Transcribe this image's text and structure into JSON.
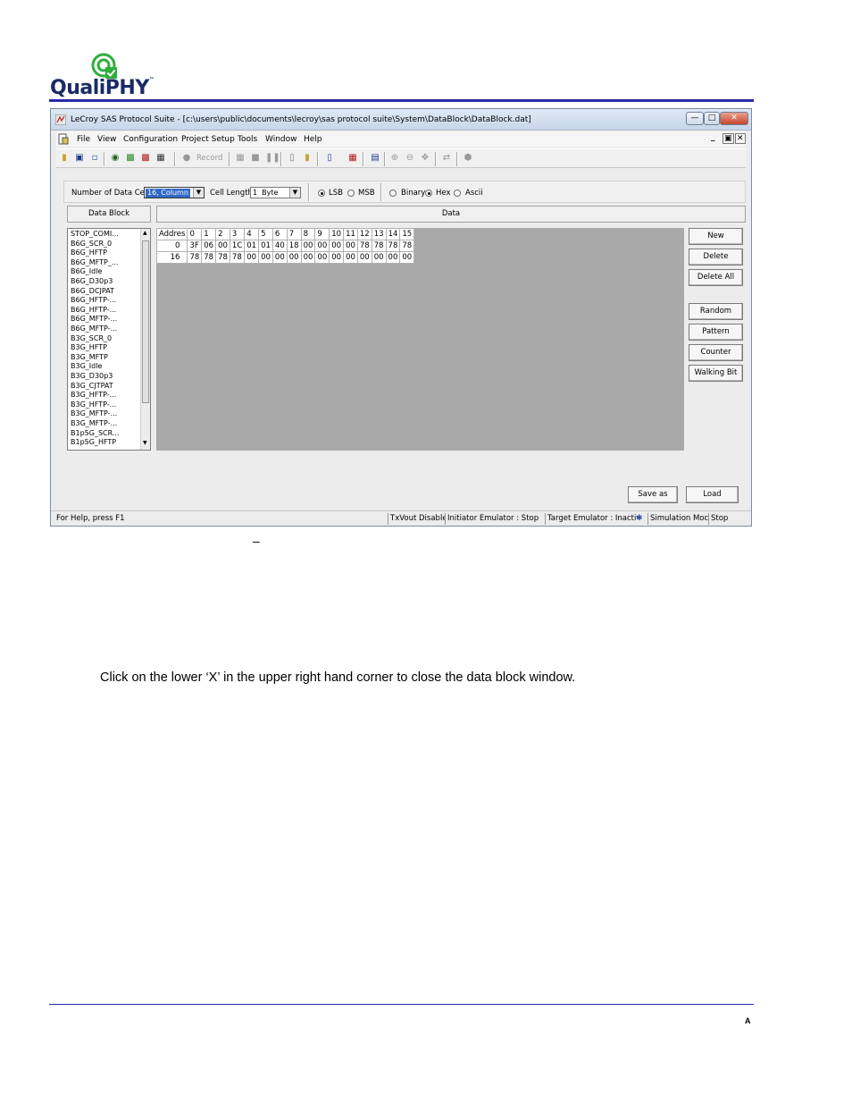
{
  "header": {
    "logo_text": "QualiPHY",
    "logo_tm": "™",
    "page_letter": "A"
  },
  "window": {
    "title": "LeCroy SAS Protocol Suite - [c:\\users\\public\\documents\\lecroy\\sas protocol suite\\System\\DataBlock\\DataBlock.dat]",
    "controls": [
      "—",
      "□",
      "✕"
    ],
    "mdi_controls": [
      "_",
      "▣",
      "✕"
    ],
    "menu": [
      "File",
      "View",
      "Configuration",
      "Project Setup",
      "Tools",
      "Window",
      "Help"
    ],
    "toolbar": {
      "record_label": "Record"
    }
  },
  "controls": {
    "num_cells_label": "Number of Data Cells:",
    "num_cells_value": "16, Column",
    "cell_length_label": "Cell Length:",
    "cell_length_value": "1  Byte",
    "bit_order": {
      "options": [
        "LSB",
        "MSB"
      ],
      "selected": "LSB"
    },
    "format": {
      "options": [
        "Binary",
        "Hex",
        "Ascii"
      ],
      "selected": "Hex"
    }
  },
  "panels": {
    "datablock_header": "Data Block",
    "data_header": "Data"
  },
  "datablock_list": [
    "STOP_COMI...",
    "B6G_SCR_0",
    "B6G_HFTP",
    "B6G_MFTP_...",
    "B6G_Idle",
    "B6G_D30p3",
    "B6G_DCJPAT",
    "B6G_HFTP-...",
    "B6G_HFTP-...",
    "B6G_MFTP-...",
    "B6G_MFTP-...",
    "B3G_SCR_0",
    "B3G_HFTP",
    "B3G_MFTP",
    "B3G_Idle",
    "B3G_D30p3",
    "B3G_CJTPAT",
    "B3G_HFTP-...",
    "B3G_HFTP-...",
    "B3G_MFTP-...",
    "B3G_MFTP-...",
    "B1p5G_SCR...",
    "B1p5G_HFTP"
  ],
  "data_grid": {
    "columns": [
      "Addres",
      "0",
      "1",
      "2",
      "3",
      "4",
      "5",
      "6",
      "7",
      "8",
      "9",
      "10",
      "11",
      "12",
      "13",
      "14",
      "15"
    ],
    "rows": [
      [
        "0",
        "3F",
        "06",
        "00",
        "1C",
        "01",
        "01",
        "40",
        "18",
        "00",
        "00",
        "00",
        "00",
        "78",
        "78",
        "78",
        "78"
      ],
      [
        "16",
        "78",
        "78",
        "78",
        "78",
        "00",
        "00",
        "00",
        "00",
        "00",
        "00",
        "00",
        "00",
        "00",
        "00",
        "00",
        "00"
      ]
    ]
  },
  "side_buttons": [
    "New",
    "Delete",
    "Delete All",
    "Random",
    "Pattern",
    "Counter",
    "Walking Bit"
  ],
  "bottom_buttons": {
    "save_as": "Save as",
    "load": "Load"
  },
  "statusbar": {
    "help": "For Help, press F1",
    "txvout": "TxVout Disable",
    "initiator": "Initiator Emulator : Stop",
    "target": "Target Emulator : Inactive",
    "simulation": "Simulation Moc",
    "stop": "Stop"
  },
  "caption": {
    "dash": "–",
    "instruction": "Click on the lower ‘X’ in the upper right hand corner to close the data block window."
  },
  "colors": {
    "brand_blue": "#2a2aa8",
    "logo_green": "#2fae3c",
    "grid_bg": "#a9a9a9",
    "selection_blue": "#3169c6"
  }
}
